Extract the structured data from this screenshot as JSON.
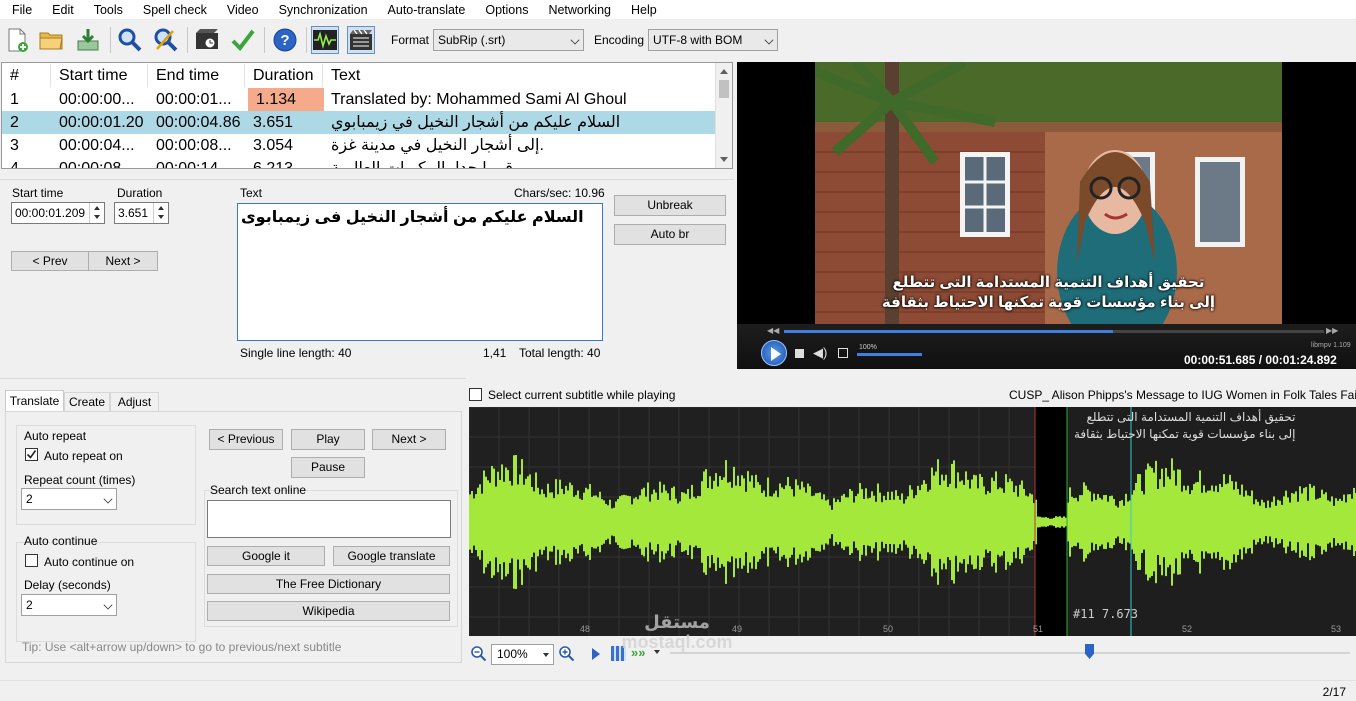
{
  "menu": [
    "File",
    "Edit",
    "Tools",
    "Spell check",
    "Video",
    "Synchronization",
    "Auto-translate",
    "Options",
    "Networking",
    "Help"
  ],
  "toolbar": {
    "format_label": "Format",
    "format_value": "SubRip (.srt)",
    "encoding_label": "Encoding",
    "encoding_value": "UTF-8 with BOM"
  },
  "grid": {
    "headers": [
      "#",
      "Start time",
      "End time",
      "Duration",
      "Text"
    ],
    "rows": [
      {
        "num": "1",
        "start": "00:00:00...",
        "end": "00:00:01...",
        "duration": "1.134",
        "text": "Translated by: Mohammed Sami Al Ghoul"
      },
      {
        "num": "2",
        "start": "00:00:01.20",
        "end": "00:00:04.86",
        "duration": "3.651",
        "text": "السلام عليكم من أشجار النخيل في زيمبابوي"
      },
      {
        "num": "3",
        "start": "00:00:04...",
        "end": "00:00:08...",
        "duration": "3.054",
        "text": "إلى أشجار النخيل في مدينة غزة."
      },
      {
        "num": "4",
        "start": "00:00:08",
        "end": "00:00:14",
        "duration": "6.213",
        "text": "قريبا جدا، المكبرات العالمية"
      }
    ]
  },
  "editor": {
    "start_label": "Start time",
    "start_value": "00:00:01.209",
    "duration_label": "Duration",
    "duration_value": "3.651",
    "text_label": "Text",
    "chars_sec": "Chars/sec: 10.96",
    "text_value": "السلام عليكم من أشجار النخيل فى زيمبابوى",
    "prev": "< Prev",
    "next": "Next >",
    "unbreak": "Unbreak",
    "auto_br": "Auto br",
    "single_line": "Single line length: 40",
    "cursor_pos": "1,41",
    "total_length": "Total length: 40"
  },
  "video": {
    "subtitle_line1": "تحقيق أهداف التنمية المستدامة التى تتطلع",
    "subtitle_line2": "إلى بناء مؤسسات قوية تمكنها الاحتياط بثقافة",
    "volume": "100%",
    "player": "libmpv 1.109",
    "time": "00:00:51.685 / 00:01:24.892"
  },
  "tabs": [
    "Translate",
    "Create",
    "Adjust"
  ],
  "translate": {
    "auto_repeat": "Auto repeat",
    "auto_repeat_on": "Auto repeat on",
    "repeat_count": "Repeat count (times)",
    "repeat_value": "2",
    "auto_continue": "Auto continue",
    "auto_continue_on": "Auto continue on",
    "delay": "Delay (seconds)",
    "delay_value": "2",
    "previous": "< Previous",
    "play": "Play",
    "next": "Next >",
    "pause": "Pause",
    "search_online": "Search text online",
    "google_it": "Google it",
    "google_translate": "Google translate",
    "free_dictionary": "The Free Dictionary",
    "wikipedia": "Wikipedia",
    "tip": "Tip: Use <alt+arrow up/down> to go to previous/next subtitle"
  },
  "waveform": {
    "select_current": "Select current subtitle while playing",
    "video_title": "CUSP_ Alison Phipps's Message to IUG Women in Folk Tales Fair in",
    "sub_line1": "تحقيق أهداف التنمية المستدامة التى تتطلع",
    "sub_line2": "إلى بناء مؤسسات قوية تمكنها الاحتياط بثقافة",
    "marker": "#11  7.673",
    "ticks": [
      "48",
      "49",
      "50",
      "51",
      "52",
      "53"
    ],
    "zoom": "100%"
  },
  "status": {
    "page": "2/17"
  },
  "watermark": "مستقل mostaql.com"
}
